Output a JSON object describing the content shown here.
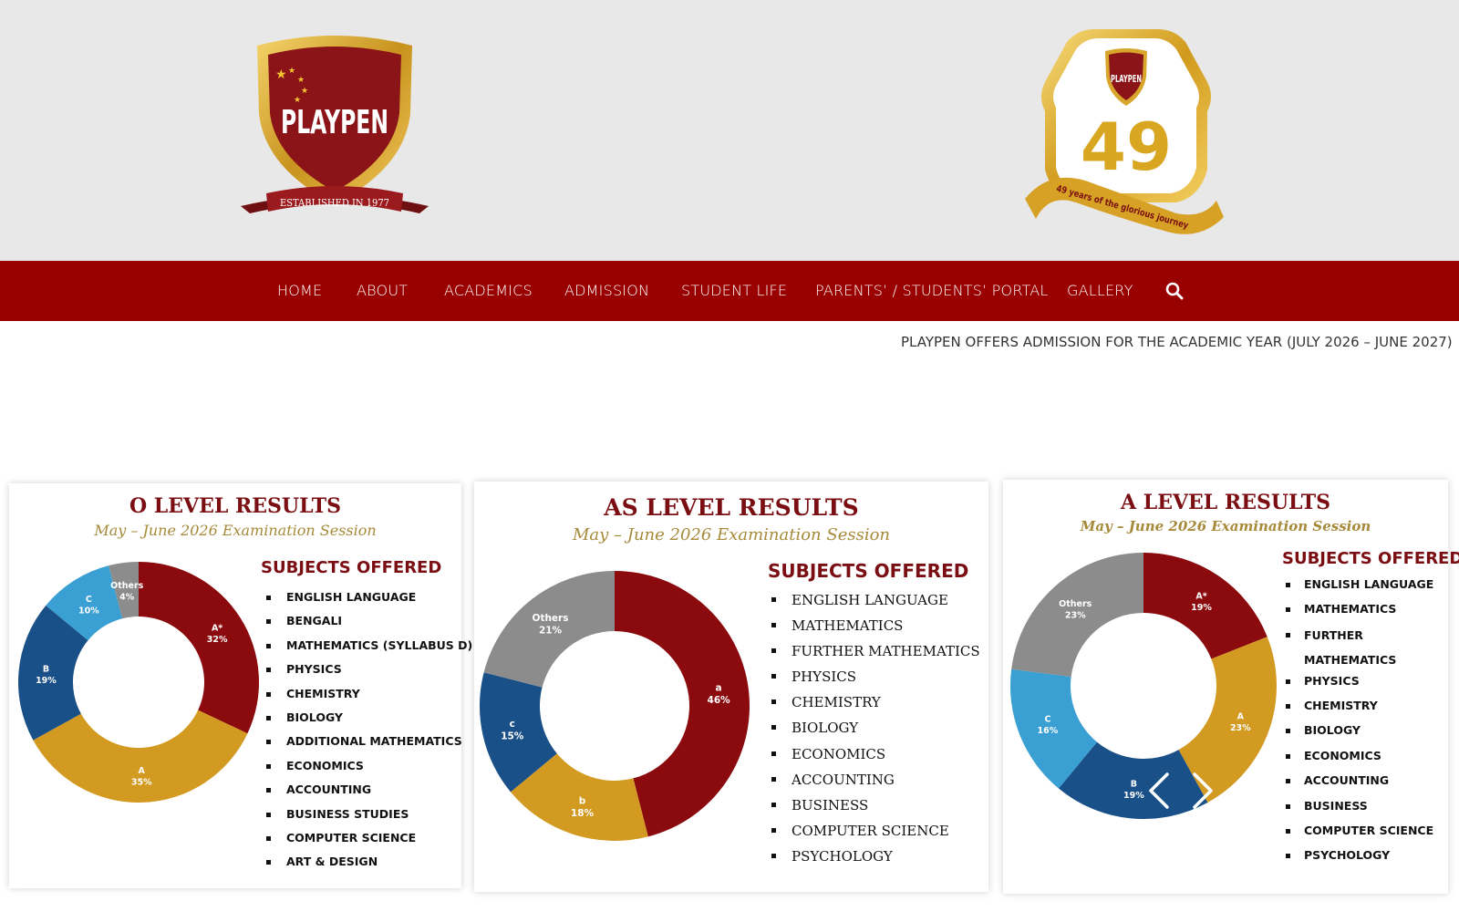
{
  "header": {
    "left_logo": {
      "name": "PLAYPEN",
      "ribbon": "ESTABLISHED IN 1977",
      "colors": {
        "shield": "#8b1418",
        "border": "#d4a52a",
        "ribbon": "#9b1a1e"
      }
    },
    "right_logo": {
      "name": "PLAYPEN",
      "number": "49",
      "ribbon": "49 years of the glorious journey",
      "colors": {
        "gold": "#d9a621",
        "red": "#8b1418"
      }
    }
  },
  "nav": {
    "items": [
      {
        "label": "HOME"
      },
      {
        "label": "ABOUT"
      },
      {
        "label": "ACADEMICS"
      },
      {
        "label": "ADMISSION"
      },
      {
        "label": "STUDENT LIFE"
      },
      {
        "label": "PARENTS’ / STUDENTS’ PORTAL"
      },
      {
        "label": "GALLERY"
      }
    ],
    "search_icon": "search-icon",
    "bg_color": "#990000"
  },
  "ticker": {
    "text": "PLAYPEN OFFERS ADMISSION FOR THE ACADEMIC YEAR (JULY 2026 – JUNE 2027)"
  },
  "cards": [
    {
      "title": "O LEVEL RESULTS",
      "subtitle": "May – June 2026 Examination Session",
      "subjects_heading": "SUBJECTS OFFERED",
      "subjects": [
        "ENGLISH LANGUAGE",
        "BENGALI",
        "MATHEMATICS (SYLLABUS D)",
        "PHYSICS",
        "CHEMISTRY",
        "BIOLOGY",
        "ADDITIONAL MATHEMATICS",
        "ECONOMICS",
        "ACCOUNTING",
        "BUSINESS STUDIES",
        "COMPUTER SCIENCE",
        "ART & DESIGN"
      ]
    },
    {
      "title": "AS LEVEL RESULTS",
      "subtitle": "May – June 2026 Examination Session",
      "subjects_heading": "SUBJECTS OFFERED",
      "subjects": [
        "ENGLISH LANGUAGE",
        "MATHEMATICS",
        "FURTHER MATHEMATICS",
        "PHYSICS",
        "CHEMISTRY",
        "BIOLOGY",
        "ECONOMICS",
        "ACCOUNTING",
        "BUSINESS",
        "COMPUTER SCIENCE",
        "PSYCHOLOGY"
      ]
    },
    {
      "title": "A LEVEL RESULTS",
      "subtitle": "May – June 2026 Examination Session",
      "subjects_heading": "SUBJECTS OFFERED",
      "subjects": [
        "ENGLISH LANGUAGE",
        "MATHEMATICS",
        "FURTHER MATHEMATICS",
        "PHYSICS",
        "CHEMISTRY",
        "BIOLOGY",
        "ECONOMICS",
        "ACCOUNTING",
        "BUSINESS",
        "COMPUTER SCIENCE",
        "PSYCHOLOGY"
      ]
    }
  ],
  "chart_data": [
    {
      "type": "pie",
      "title": "O LEVEL RESULTS",
      "categories": [
        "A*",
        "A",
        "B",
        "C",
        "Others"
      ],
      "values": [
        32,
        35,
        19,
        10,
        4
      ],
      "colors": [
        "#8b0a0e",
        "#d39a22",
        "#1a5088",
        "#3a9fd2",
        "#8c8c8c"
      ],
      "donut": true
    },
    {
      "type": "pie",
      "title": "AS LEVEL RESULTS",
      "categories": [
        "a",
        "b",
        "c",
        "Others"
      ],
      "values": [
        46,
        18,
        15,
        21
      ],
      "colors": [
        "#8b0a0e",
        "#d39a22",
        "#1a5088",
        "#8c8c8c"
      ],
      "donut": true
    },
    {
      "type": "pie",
      "title": "A LEVEL RESULTS",
      "categories": [
        "A*",
        "A",
        "B",
        "C",
        "Others"
      ],
      "values": [
        19,
        23,
        19,
        16,
        23
      ],
      "colors": [
        "#8b0a0e",
        "#d39a22",
        "#1a5088",
        "#3a9fd2",
        "#8c8c8c"
      ],
      "donut": true
    }
  ],
  "carousel": {
    "prev_icon": "chevron-left-icon",
    "next_icon": "chevron-right-icon"
  }
}
